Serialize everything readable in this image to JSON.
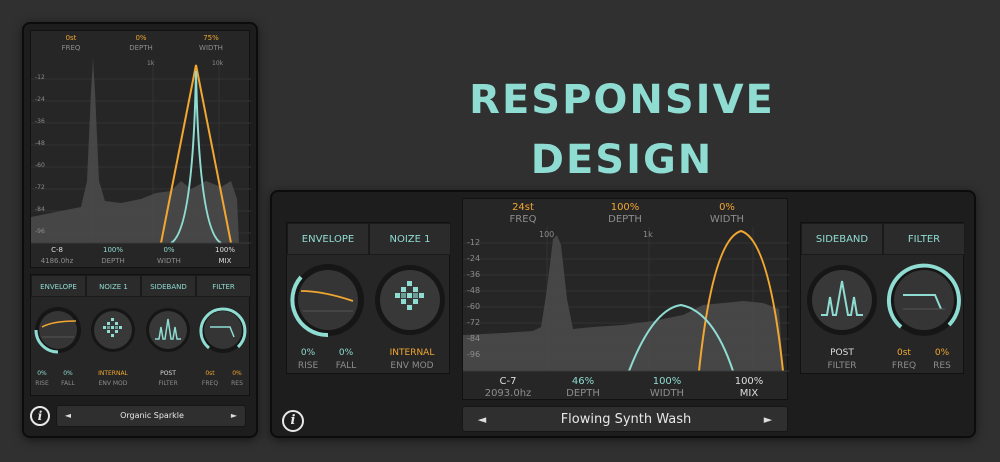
{
  "headline": "RESPONSIVE DESIGN",
  "colors": {
    "accent_teal": "#8fdcd3",
    "accent_orange": "#f1a731",
    "background": "#303030"
  },
  "portrait": {
    "top_readout": [
      {
        "value": "0st",
        "label": "FREQ"
      },
      {
        "value": "0%",
        "label": "DEPTH"
      },
      {
        "value": "75%",
        "label": "WIDTH"
      }
    ],
    "freq_marks": [
      "1k",
      "10k"
    ],
    "db_scale": [
      "-12",
      "-24",
      "-36",
      "-48",
      "-60",
      "-72",
      "-84",
      "-96"
    ],
    "bottom_readout": [
      {
        "value": "C-8",
        "label": "4186.0hz"
      },
      {
        "value": "100%",
        "label": "DEPTH"
      },
      {
        "value": "0%",
        "label": "WIDTH"
      },
      {
        "value": "100%",
        "label": "MIX"
      }
    ],
    "tabs": [
      "ENVELOPE",
      "NOIZE 1",
      "SIDEBAND",
      "FILTER"
    ],
    "knob_icons": [
      "envelope-curve-icon",
      "noise-diamond-icon",
      "sideband-peaks-icon",
      "lowpass-filter-icon"
    ],
    "params": [
      {
        "value": "0%",
        "label": "RISE"
      },
      {
        "value": "0%",
        "label": "FALL"
      },
      {
        "value": "INTERNAL",
        "label": "ENV MOD"
      },
      {
        "value": "POST",
        "label": "FILTER"
      },
      {
        "value": "0st",
        "label": "FREQ"
      },
      {
        "value": "0%",
        "label": "RES"
      }
    ],
    "preset_name": "Organic Sparkle",
    "prev": "◄",
    "next": "►",
    "info": "i"
  },
  "landscape": {
    "left_tabs": [
      "ENVELOPE",
      "NOIZE 1"
    ],
    "right_tabs": [
      "SIDEBAND",
      "FILTER"
    ],
    "top_readout": [
      {
        "value": "24st",
        "label": "FREQ"
      },
      {
        "value": "100%",
        "label": "DEPTH"
      },
      {
        "value": "0%",
        "label": "WIDTH"
      }
    ],
    "freq_marks": [
      "100",
      "1k"
    ],
    "db_scale": [
      "-12",
      "-24",
      "-36",
      "-48",
      "-60",
      "-72",
      "-84",
      "-96"
    ],
    "bottom_readout": [
      {
        "value": "C-7",
        "label": "2093.0hz"
      },
      {
        "value": "46%",
        "label": "DEPTH"
      },
      {
        "value": "100%",
        "label": "WIDTH"
      },
      {
        "value": "100%",
        "label": "MIX"
      }
    ],
    "left_params": [
      {
        "value": "0%",
        "label": "RISE"
      },
      {
        "value": "0%",
        "label": "FALL"
      },
      {
        "value": "INTERNAL",
        "label": "ENV MOD"
      }
    ],
    "right_params": [
      {
        "value": "POST",
        "label": "FILTER"
      },
      {
        "value": "0st",
        "label": "FREQ"
      },
      {
        "value": "0%",
        "label": "RES"
      }
    ],
    "preset_name": "Flowing Synth Wash",
    "prev": "◄",
    "next": "►",
    "info": "i"
  }
}
